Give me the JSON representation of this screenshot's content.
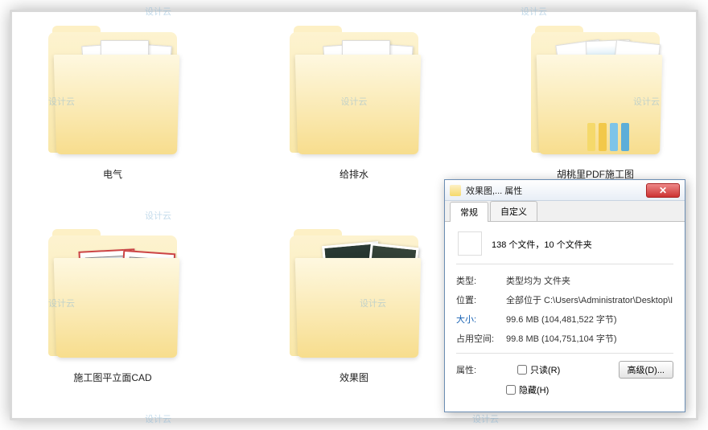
{
  "watermark_text": "设计云",
  "folders": [
    {
      "label": "电气"
    },
    {
      "label": "给排水"
    },
    {
      "label": "胡桃里PDF施工图"
    },
    {
      "label": "施工图平立面CAD"
    },
    {
      "label": "效果图"
    }
  ],
  "dialog": {
    "title": "效果图,... 属性",
    "close_glyph": "✕",
    "tabs": {
      "general": "常规",
      "custom": "自定义"
    },
    "summary": "138 个文件，10 个文件夹",
    "rows": {
      "type_label": "类型:",
      "type_value": "类型均为 文件夹",
      "location_label": "位置:",
      "location_value": "全部位于 C:\\Users\\Administrator\\Desktop\\I",
      "size_label": "大小:",
      "size_value": "99.6 MB (104,481,522 字节)",
      "ondisk_label": "占用空间:",
      "ondisk_value": "99.8 MB (104,751,104 字节)",
      "attr_label": "属性:"
    },
    "checkboxes": {
      "readonly": "只读(R)",
      "hidden": "隐藏(H)"
    },
    "advanced_button": "高级(D)..."
  }
}
